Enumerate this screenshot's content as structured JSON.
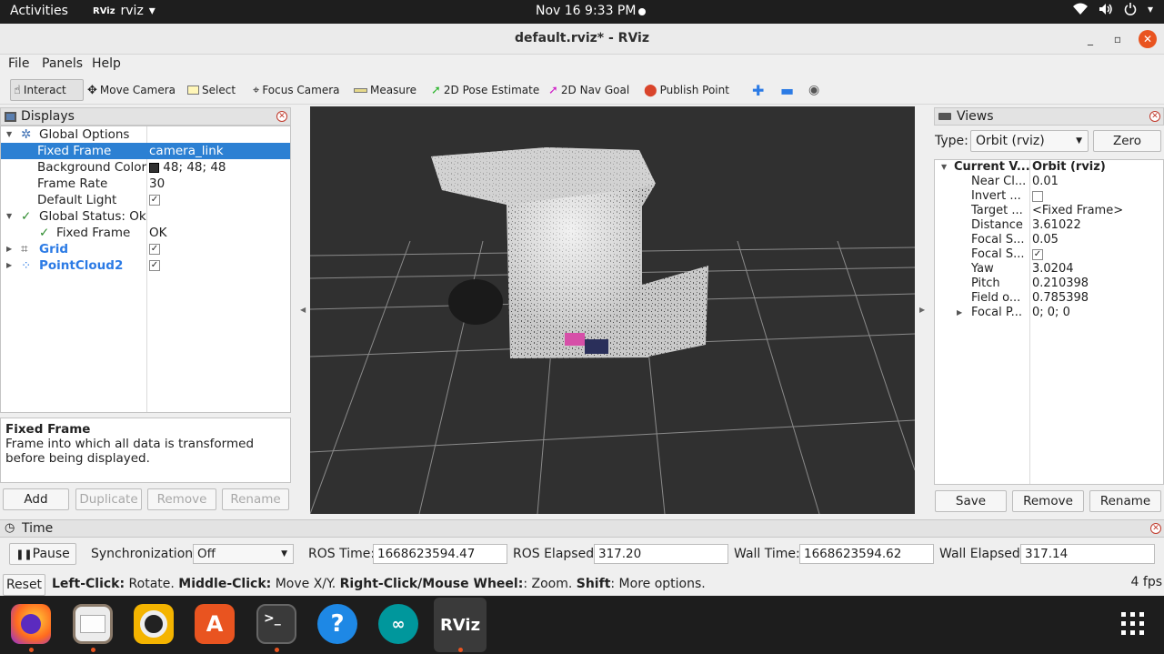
{
  "topbar": {
    "activities": "Activities",
    "app_name": "rviz",
    "app_logo": "RViz",
    "clock": "Nov 16  9:33 PM",
    "tray_icons": [
      "wifi-icon",
      "volume-icon",
      "power-icon",
      "chevron-down-icon"
    ]
  },
  "window": {
    "title": "default.rviz* - RViz",
    "minimize": "_",
    "maximize": "▫",
    "close": "✕"
  },
  "menu": {
    "file": "File",
    "panels": "Panels",
    "help": "Help"
  },
  "toolbar": {
    "interact": "Interact",
    "move_camera": "Move Camera",
    "select": "Select",
    "focus_camera": "Focus Camera",
    "measure": "Measure",
    "pose_estimate": "2D Pose Estimate",
    "nav_goal": "2D Nav Goal",
    "publish_point": "Publish Point"
  },
  "displays": {
    "title": "Displays",
    "global_options": "Global Options",
    "fixed_frame_label": "Fixed Frame",
    "fixed_frame_value": "camera_link",
    "background_color_label": "Background Color",
    "background_color_value": "48; 48; 48",
    "frame_rate_label": "Frame Rate",
    "frame_rate_value": "30",
    "default_light_label": "Default Light",
    "global_status_label": "Global Status: Ok",
    "status_fixed_frame_label": "Fixed Frame",
    "status_fixed_frame_value": "OK",
    "grid_label": "Grid",
    "pointcloud_label": "PointCloud2",
    "help_title": "Fixed Frame",
    "help_text": "Frame into which all data is transformed before being displayed.",
    "add": "Add",
    "duplicate": "Duplicate",
    "remove": "Remove",
    "rename": "Rename"
  },
  "views": {
    "title": "Views",
    "type_label": "Type:",
    "type_value": "Orbit (rviz)",
    "zero": "Zero",
    "current_view_label": "Current V...",
    "current_view_value": "Orbit (rviz)",
    "rows": [
      {
        "label": "Near Cl...",
        "value": "0.01"
      },
      {
        "label": "Invert ...",
        "value": ""
      },
      {
        "label": "Target ...",
        "value": "<Fixed Frame>"
      },
      {
        "label": "Distance",
        "value": "3.61022"
      },
      {
        "label": "Focal S...",
        "value": "0.05"
      },
      {
        "label": "Focal S...",
        "value": ""
      },
      {
        "label": "Yaw",
        "value": "3.0204"
      },
      {
        "label": "Pitch",
        "value": "0.210398"
      },
      {
        "label": "Field o...",
        "value": "0.785398"
      },
      {
        "label": "Focal P...",
        "value": "0; 0; 0"
      }
    ],
    "save": "Save",
    "remove": "Remove",
    "rename": "Rename"
  },
  "time": {
    "title": "Time",
    "pause": "Pause",
    "sync_label": "Synchronization:",
    "sync_value": "Off",
    "ros_time_label": "ROS Time:",
    "ros_time_value": "1668623594.47",
    "ros_elapsed_label": "ROS Elapsed:",
    "ros_elapsed_value": "317.20",
    "wall_time_label": "Wall Time:",
    "wall_time_value": "1668623594.62",
    "wall_elapsed_label": "Wall Elapsed:",
    "wall_elapsed_value": "317.14"
  },
  "status": {
    "reset": "Reset",
    "left_click": "Left-Click:",
    "left_click_text": " Rotate. ",
    "middle_click": "Middle-Click:",
    "middle_click_text": " Move X/Y. ",
    "right_click": "Right-Click/Mouse Wheel:",
    "right_click_text": ": Zoom. ",
    "shift": "Shift",
    "shift_text": ": More options.",
    "fps": "4 fps"
  },
  "dock": {
    "apps": [
      "firefox-icon",
      "files-icon",
      "rhythmbox-icon",
      "app-center-icon",
      "terminal-icon",
      "help-icon",
      "arduino-icon",
      "rviz-icon",
      "show-apps-icon"
    ],
    "rviz_label": "RViz",
    "terminal_label": ">_",
    "help_label": "?"
  },
  "colors": {
    "accent": "#e95420",
    "selection": "#2c80d3",
    "render_bg": "#303030"
  }
}
